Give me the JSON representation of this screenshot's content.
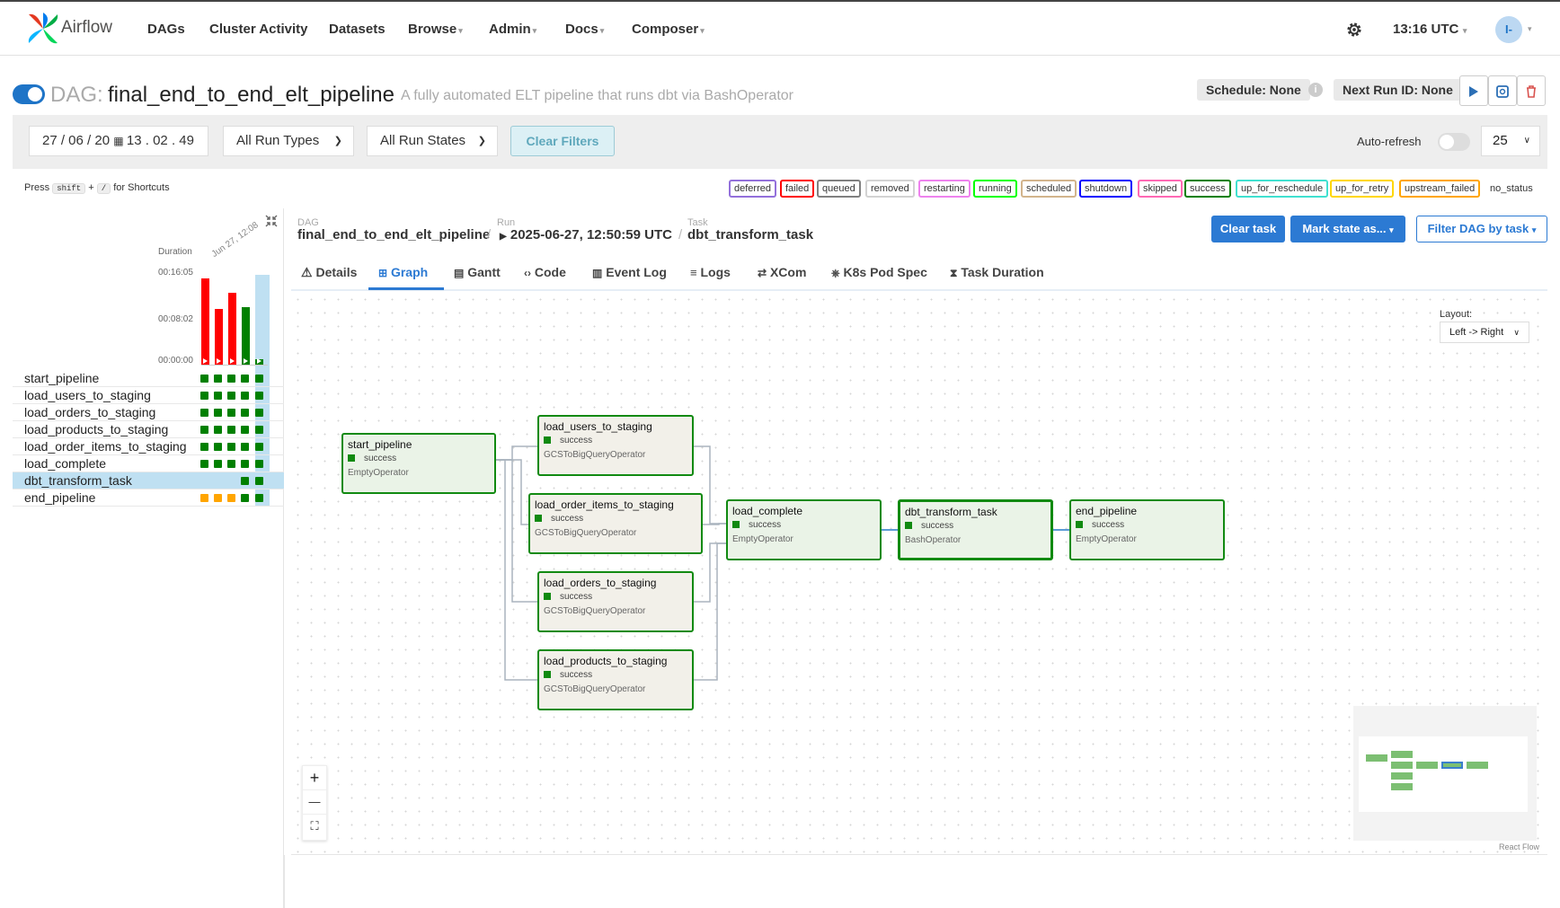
{
  "app": {
    "name": "Airflow",
    "time": "13:16 UTC",
    "user_initials": "I-"
  },
  "nav": [
    {
      "label": "DAGs",
      "has_caret": false
    },
    {
      "label": "Cluster Activity",
      "has_caret": false
    },
    {
      "label": "Datasets",
      "has_caret": false
    },
    {
      "label": "Browse",
      "has_caret": true
    },
    {
      "label": "Admin",
      "has_caret": true
    },
    {
      "label": "Docs",
      "has_caret": true
    },
    {
      "label": "Composer",
      "has_caret": true
    }
  ],
  "dag": {
    "label": "DAG:",
    "id": "final_end_to_end_elt_pipeline",
    "description": "A fully automated ELT pipeline that runs dbt via BashOperator",
    "schedule": "Schedule: None",
    "next_run": "Next Run ID: None",
    "paused": false
  },
  "filters": {
    "date": "27 / 06 / 20",
    "time": "13 . 02 . 49",
    "run_types": "All Run Types",
    "run_states": "All Run States",
    "clear_label": "Clear Filters",
    "auto_refresh_label": "Auto-refresh",
    "num_runs": "25"
  },
  "shortcut": {
    "press": "Press",
    "key1": "shift",
    "plus": "+",
    "key2": "/",
    "suffix": "for Shortcuts"
  },
  "legend": [
    {
      "label": "deferred",
      "color": "#9370db"
    },
    {
      "label": "failed",
      "color": "#ff0000"
    },
    {
      "label": "queued",
      "color": "#808080"
    },
    {
      "label": "removed",
      "color": "#d3d3d3"
    },
    {
      "label": "restarting",
      "color": "#ee82ee"
    },
    {
      "label": "running",
      "color": "#00ff00"
    },
    {
      "label": "scheduled",
      "color": "#d2b48c"
    },
    {
      "label": "shutdown",
      "color": "#0000ff"
    },
    {
      "label": "skipped",
      "color": "#ff69b4"
    },
    {
      "label": "success",
      "color": "#008000"
    },
    {
      "label": "up_for_reschedule",
      "color": "#40e0d0"
    },
    {
      "label": "up_for_retry",
      "color": "#ffd700"
    },
    {
      "label": "upstream_failed",
      "color": "#ffa500"
    },
    {
      "label": "no_status",
      "color": "#ffffff"
    }
  ],
  "grid": {
    "duration_label": "Duration",
    "y_ticks": [
      "00:16:05",
      "00:08:02",
      "00:00:00"
    ],
    "date_tick": "Jun 27, 12:08",
    "runs": [
      {
        "duration_fraction": 0.96,
        "color": "#ff0000"
      },
      {
        "duration_fraction": 0.62,
        "color": "#ff0000"
      },
      {
        "duration_fraction": 0.8,
        "color": "#ff0000"
      },
      {
        "duration_fraction": 0.64,
        "color": "#008000"
      },
      {
        "duration_fraction": 0.04,
        "color": "#008000"
      }
    ],
    "tasks": [
      {
        "name": "start_pipeline",
        "states": [
          "success",
          "success",
          "success",
          "success",
          "success"
        ]
      },
      {
        "name": "load_users_to_staging",
        "states": [
          "success",
          "success",
          "success",
          "success",
          "success"
        ]
      },
      {
        "name": "load_orders_to_staging",
        "states": [
          "success",
          "success",
          "success",
          "success",
          "success"
        ]
      },
      {
        "name": "load_products_to_staging",
        "states": [
          "success",
          "success",
          "success",
          "success",
          "success"
        ]
      },
      {
        "name": "load_order_items_to_staging",
        "states": [
          "success",
          "success",
          "success",
          "success",
          "success"
        ]
      },
      {
        "name": "load_complete",
        "states": [
          "success",
          "success",
          "success",
          "success",
          "success"
        ]
      },
      {
        "name": "dbt_transform_task",
        "states": [
          "none",
          "none",
          "none",
          "success",
          "success"
        ]
      },
      {
        "name": "end_pipeline",
        "states": [
          "upstream_failed",
          "upstream_failed",
          "upstream_failed",
          "success",
          "success"
        ]
      }
    ],
    "selected_task": "dbt_transform_task"
  },
  "breadcrumb": {
    "dag_label": "DAG",
    "dag_value": "final_end_to_end_elt_pipeline",
    "run_label": "Run",
    "run_value": "2025-06-27, 12:50:59 UTC",
    "task_label": "Task",
    "task_value": "dbt_transform_task"
  },
  "actions": {
    "clear_task": "Clear task",
    "mark_state": "Mark state as...",
    "filter_dag": "Filter DAG by task"
  },
  "tabs": [
    {
      "label": "Details",
      "icon": "warning-icon"
    },
    {
      "label": "Graph",
      "icon": "graph-icon",
      "active": true
    },
    {
      "label": "Gantt",
      "icon": "gantt-icon"
    },
    {
      "label": "Code",
      "icon": "code-icon"
    },
    {
      "label": "Event Log",
      "icon": "event-log-icon"
    },
    {
      "label": "Logs",
      "icon": "logs-icon"
    },
    {
      "label": "XCom",
      "icon": "xcom-icon"
    },
    {
      "label": "K8s Pod Spec",
      "icon": "k8s-icon"
    },
    {
      "label": "Task Duration",
      "icon": "hourglass-icon"
    }
  ],
  "graph": {
    "layout_label": "Layout:",
    "layout_value": "Left -> Right",
    "nodes": [
      {
        "id": "start_pipeline",
        "state": "success",
        "operator": "EmptyOperator"
      },
      {
        "id": "load_users_to_staging",
        "state": "success",
        "operator": "GCSToBigQueryOperator"
      },
      {
        "id": "load_order_items_to_staging",
        "state": "success",
        "operator": "GCSToBigQueryOperator"
      },
      {
        "id": "load_orders_to_staging",
        "state": "success",
        "operator": "GCSToBigQueryOperator"
      },
      {
        "id": "load_products_to_staging",
        "state": "success",
        "operator": "GCSToBigQueryOperator"
      },
      {
        "id": "load_complete",
        "state": "success",
        "operator": "EmptyOperator"
      },
      {
        "id": "dbt_transform_task",
        "state": "success",
        "operator": "BashOperator"
      },
      {
        "id": "end_pipeline",
        "state": "success",
        "operator": "EmptyOperator"
      }
    ],
    "zoom_in": "+",
    "zoom_out": "—",
    "fit": "⛶",
    "attribution": "React Flow"
  }
}
